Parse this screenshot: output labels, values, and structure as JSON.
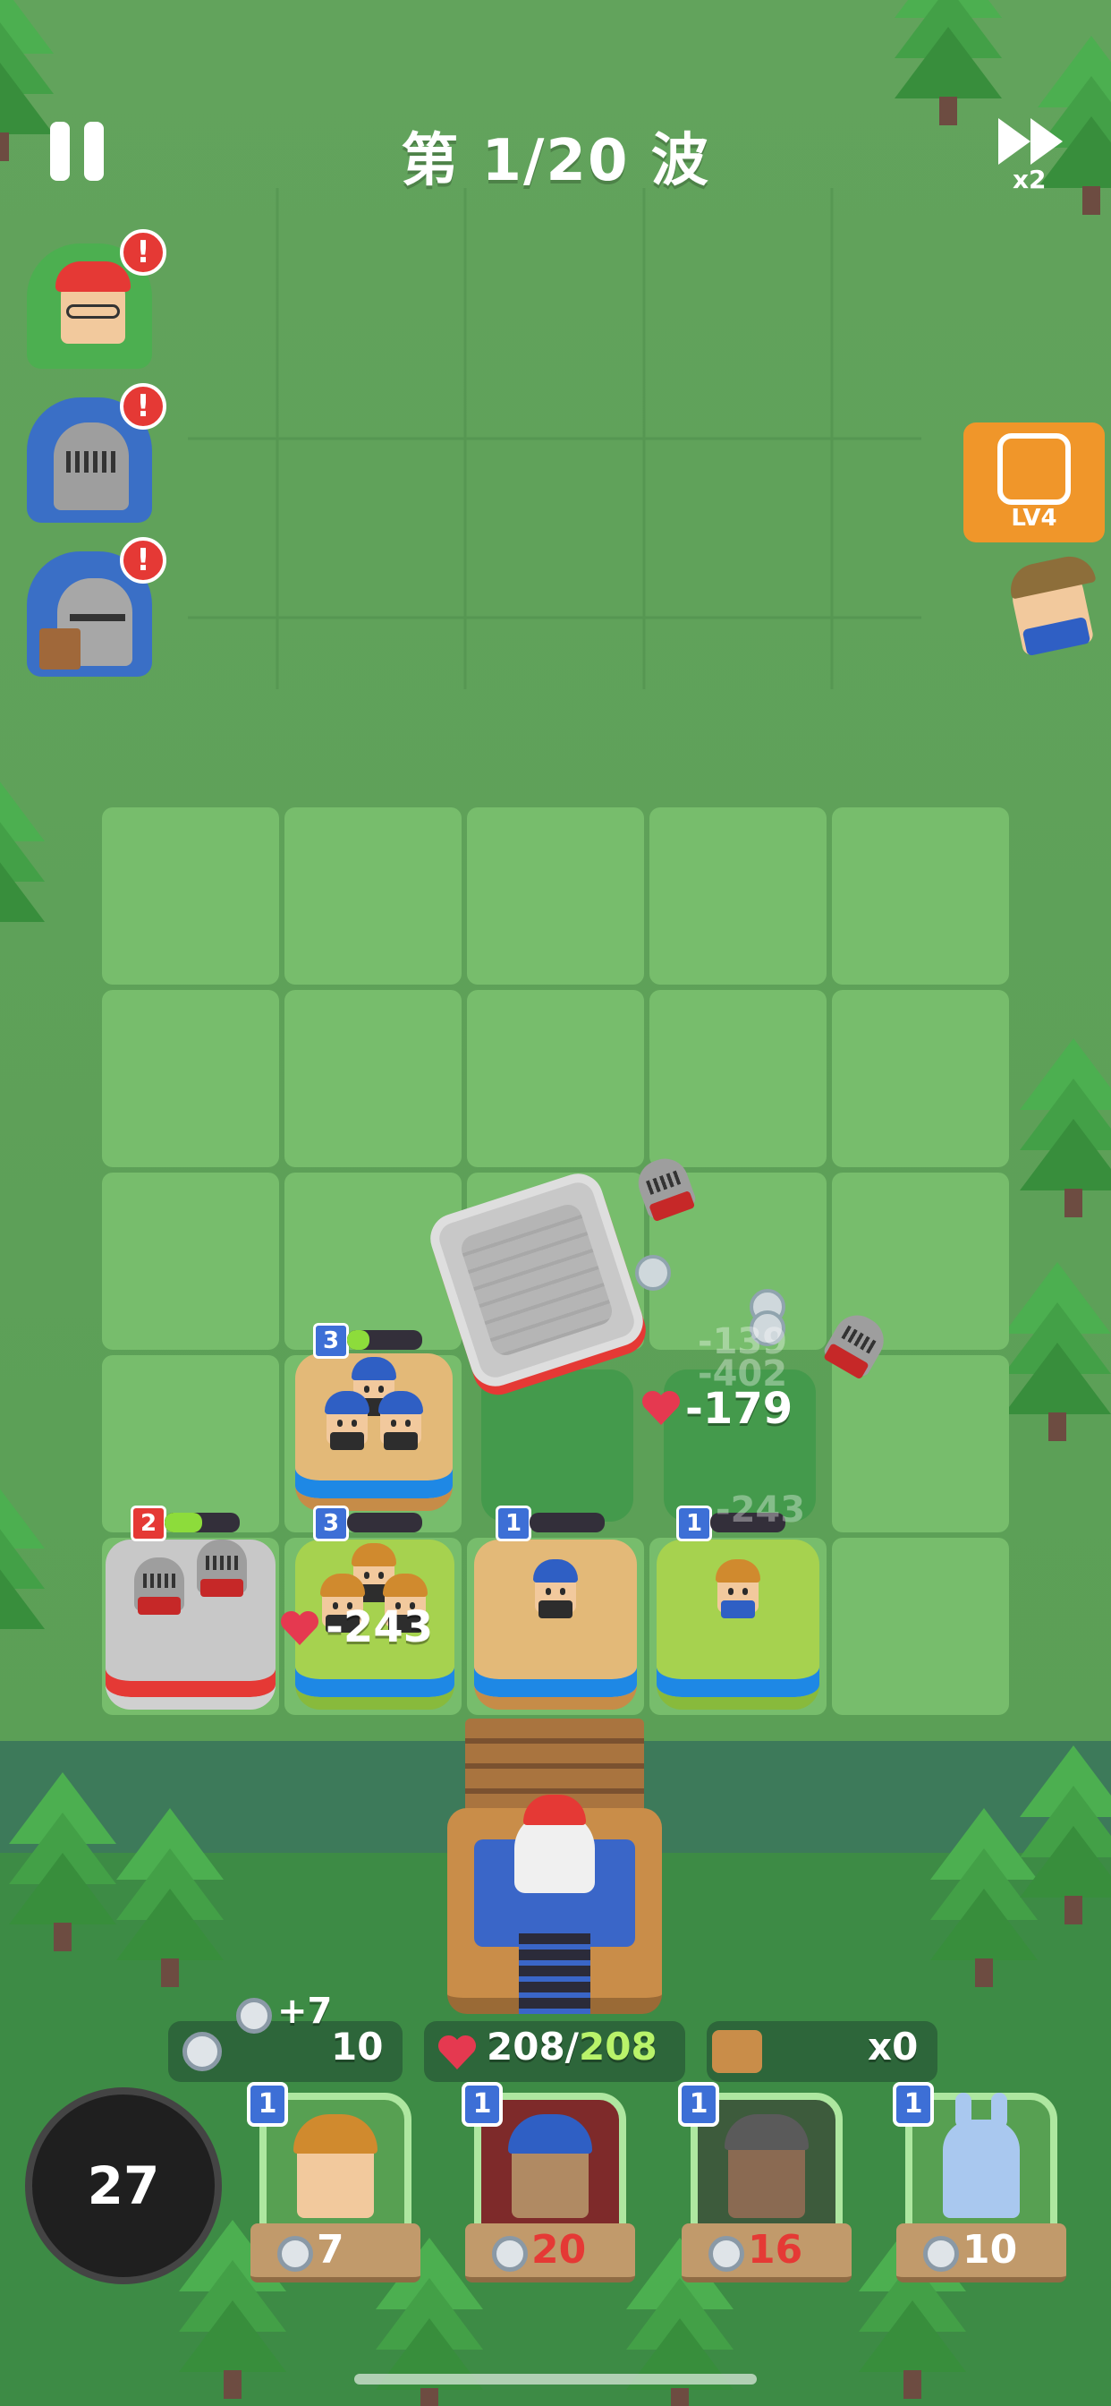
{
  "hud": {
    "wave_title": "第 1/20 波",
    "speed_label": "x2",
    "lv_label": "LV4"
  },
  "enemy_queue": [
    {
      "name": "red-hat-enemy",
      "alert": "!"
    },
    {
      "name": "knight-enemy",
      "alert": "!"
    },
    {
      "name": "shield-knight-enemy",
      "alert": "!"
    }
  ],
  "board_units": [
    {
      "name": "knight-squad",
      "level": "2",
      "hp_fraction": 0.5
    },
    {
      "name": "blue-hood-squad-top",
      "level": "3",
      "hp_fraction": 0.3
    },
    {
      "name": "archer-squad",
      "level": "3",
      "hp_fraction": 0.0
    },
    {
      "name": "blue-hood-single",
      "level": "1",
      "hp_fraction": 0.0
    },
    {
      "name": "swordsman-single",
      "level": "1",
      "hp_fraction": 0.0
    }
  ],
  "damage_popups": [
    {
      "text": "-179",
      "style": "bright"
    },
    {
      "text": "-243",
      "style": "bright"
    },
    {
      "text": "-139",
      "style": "faded"
    },
    {
      "text": "-402",
      "style": "faded"
    },
    {
      "text": "-243",
      "style": "faded"
    }
  ],
  "stats": {
    "coin_gain": "+7",
    "coins": "10",
    "hp_current": "208",
    "hp_separator": "/",
    "hp_max": "208",
    "items": "x0"
  },
  "timer": "27",
  "shop_cards": [
    {
      "level": "1",
      "price": "7",
      "affordable": true,
      "name": "swordsman-card"
    },
    {
      "level": "1",
      "price": "20",
      "affordable": false,
      "name": "blue-hood-card"
    },
    {
      "level": "1",
      "price": "16",
      "affordable": false,
      "name": "warrior-card"
    },
    {
      "level": "1",
      "price": "10",
      "affordable": true,
      "name": "bunny-card"
    }
  ],
  "colors": {
    "grass": "#5fa457",
    "tile_light": "#77bd6c",
    "level_blue": "#3d6fd6",
    "level_red": "#e53935",
    "hp_green": "#8ddc3b",
    "lv_badge_orange": "#f0962a"
  }
}
